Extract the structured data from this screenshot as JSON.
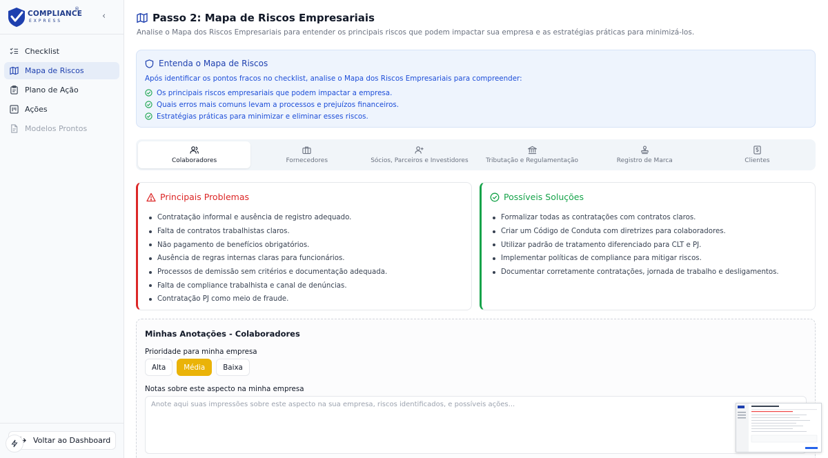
{
  "brand": {
    "name": "COMPLIANCE",
    "sub": "EXPRESS",
    "registered": "®"
  },
  "sidebar": {
    "items": [
      {
        "label": "Checklist",
        "icon": "list-check-icon"
      },
      {
        "label": "Mapa de Riscos",
        "icon": "map-icon",
        "active": true
      },
      {
        "label": "Plano de Ação",
        "icon": "clipboard-icon"
      },
      {
        "label": "Ações",
        "icon": "kanban-icon"
      },
      {
        "label": "Modelos Prontos",
        "icon": "file-icon",
        "disabled": true
      }
    ],
    "back_label": "Voltar ao Dashboard"
  },
  "page": {
    "title": "Passo 2: Mapa de Riscos Empresariais",
    "subtitle": "Analise o Mapa dos Riscos Empresariais para entender os principais riscos que podem impactar sua empresa e as estratégias práticas para minimizá-los."
  },
  "info": {
    "title": "Entenda o Mapa de Riscos",
    "lead": "Após identificar os pontos fracos no checklist, analise o Mapa dos Riscos Empresariais para compreender:",
    "items": [
      "Os principais riscos empresariais que podem impactar a empresa.",
      "Quais erros mais comuns levam a processos e prejuízos financeiros.",
      "Estratégias práticas para minimizar e eliminar esses riscos."
    ]
  },
  "tabs": [
    {
      "label": "Colaboradores",
      "icon": "users-icon",
      "active": true
    },
    {
      "label": "Fornecedores",
      "icon": "briefcase-icon"
    },
    {
      "label": "Sócios, Parceiros e Investidores",
      "icon": "user-plus-icon"
    },
    {
      "label": "Tributação e Regulamentação",
      "icon": "landmark-icon"
    },
    {
      "label": "Registro de Marca",
      "icon": "stamp-icon"
    },
    {
      "label": "Clientes",
      "icon": "receipt-icon"
    }
  ],
  "problems": {
    "title": "Principais Problemas",
    "items": [
      "Contratação informal e ausência de registro adequado.",
      "Falta de contratos trabalhistas claros.",
      "Não pagamento de benefícios obrigatórios.",
      "Ausência de regras internas claras para funcionários.",
      "Processos de demissão sem critérios e documentação adequada.",
      "Falta de compliance trabalhista e canal de denúncias.",
      "Contratação PJ como meio de fraude."
    ]
  },
  "solutions": {
    "title": "Possíveis Soluções",
    "items": [
      "Formalizar todas as contratações com contratos claros.",
      "Criar um Código de Conduta com diretrizes para colaboradores.",
      "Utilizar padrão de tratamento diferenciado para CLT e PJ.",
      "Implementar políticas de compliance para mitigar riscos.",
      "Documentar corretamente contratações, jornada de trabalho e desligamentos."
    ]
  },
  "notes": {
    "title": "Minhas Anotações - Colaboradores",
    "priority_label": "Prioridade para minha empresa",
    "priorities": [
      "Alta",
      "Média",
      "Baixa"
    ],
    "selected_priority": "Média",
    "notes_label": "Notas sobre este aspecto na minha empresa",
    "placeholder": "Anote aqui suas impressões sobre este aspecto na sua empresa, riscos identificados, e possíveis ações..."
  },
  "colors": {
    "primary": "#1e40af",
    "active_bg": "#e6edf8",
    "problem": "#dc2626",
    "solution": "#16a34a",
    "priority_selected": "#eab308"
  }
}
